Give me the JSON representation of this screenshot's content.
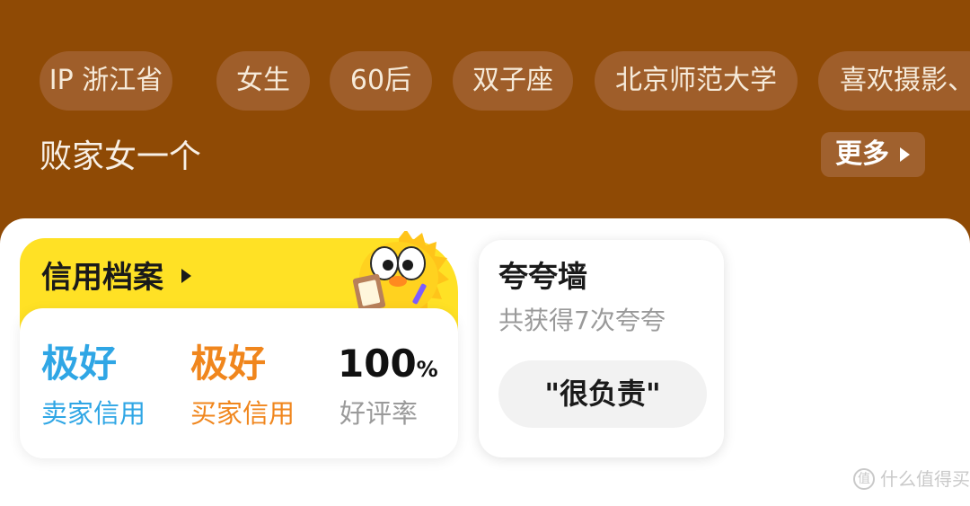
{
  "profile": {
    "tags": [
      "IP 浙江省",
      "女生",
      "60后",
      "双子座",
      "北京师范大学",
      "喜欢摄影、"
    ],
    "bio": "败家女一个",
    "more_label": "更多"
  },
  "credit": {
    "title": "信用档案",
    "stats": [
      {
        "value": "极好",
        "label": "卖家信用",
        "color": "#2fa6e5"
      },
      {
        "value": "极好",
        "label": "买家信用",
        "color": "#f0861d"
      },
      {
        "value": "100",
        "unit": "%",
        "label": "好评率",
        "color": "#111111"
      }
    ]
  },
  "praise": {
    "title": "夸夸墙",
    "subtitle": "共获得7次夸夸",
    "pill": "\"很负责\""
  },
  "watermark": {
    "icon_text": "值",
    "text": "什么值得买"
  },
  "colors": {
    "header_bg": "#8f4a05",
    "tag_bg": "#9f5e2a",
    "credit_yellow": "#ffe125"
  }
}
